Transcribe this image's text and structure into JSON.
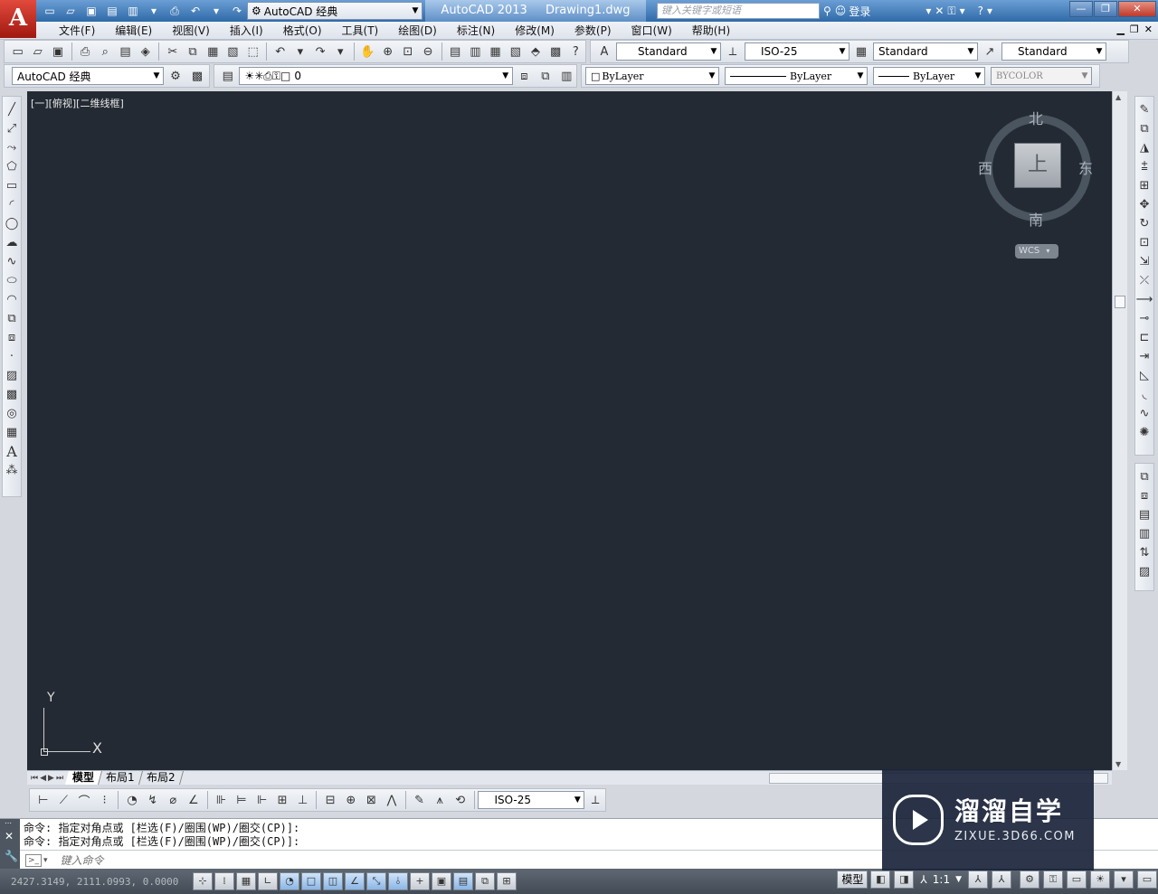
{
  "titlebar": {
    "logo": "A",
    "workspace": "AutoCAD 经典",
    "app_name": "AutoCAD 2013",
    "file_name": "Drawing1.dwg",
    "search_placeholder": "键入关键字或短语",
    "login": "登录",
    "minimize": "—",
    "restore": "❐",
    "close": "✕"
  },
  "menubar": {
    "items": [
      "文件(F)",
      "编辑(E)",
      "视图(V)",
      "插入(I)",
      "格式(O)",
      "工具(T)",
      "绘图(D)",
      "标注(N)",
      "修改(M)",
      "参数(P)",
      "窗口(W)",
      "帮助(H)"
    ]
  },
  "styles_toolbar": {
    "text_style": "Standard",
    "dim_style": "ISO-25",
    "table_style": "Standard",
    "multileader_style": "Standard"
  },
  "layers_toolbar": {
    "workspace": "AutoCAD 经典",
    "current_layer": "0",
    "color": "ByLayer",
    "linetype": "ByLayer",
    "lineweight": "ByLayer",
    "plot_style": "BYCOLOR"
  },
  "drawing": {
    "viewport_label": "[一][俯视][二维线框]",
    "viewcube": {
      "north": "北",
      "south": "南",
      "west": "西",
      "east": "东",
      "face": "上",
      "wcs": "WCS"
    },
    "ucs": {
      "x": "X",
      "y": "Y"
    }
  },
  "layout_tabs": [
    "模型",
    "布局1",
    "布局2"
  ],
  "dim_toolbar": {
    "dim_style": "ISO-25"
  },
  "command": {
    "history": [
      "命令: 指定对角点或 [栏选(F)/圈围(WP)/圈交(CP)]:",
      "命令: 指定对角点或 [栏选(F)/圈围(WP)/圈交(CP)]:"
    ],
    "input_placeholder": "键入命令"
  },
  "statusbar": {
    "coords": "2427.3149, 2111.0993, 0.0000",
    "model": "模型",
    "scale": "1:1"
  },
  "watermark": {
    "title": "溜溜自学",
    "url": "ZIXUE.3D66.COM"
  },
  "colors": {
    "canvas": "#232a33",
    "titlebar": "#2f6aa8",
    "statusbar": "#434b55"
  }
}
